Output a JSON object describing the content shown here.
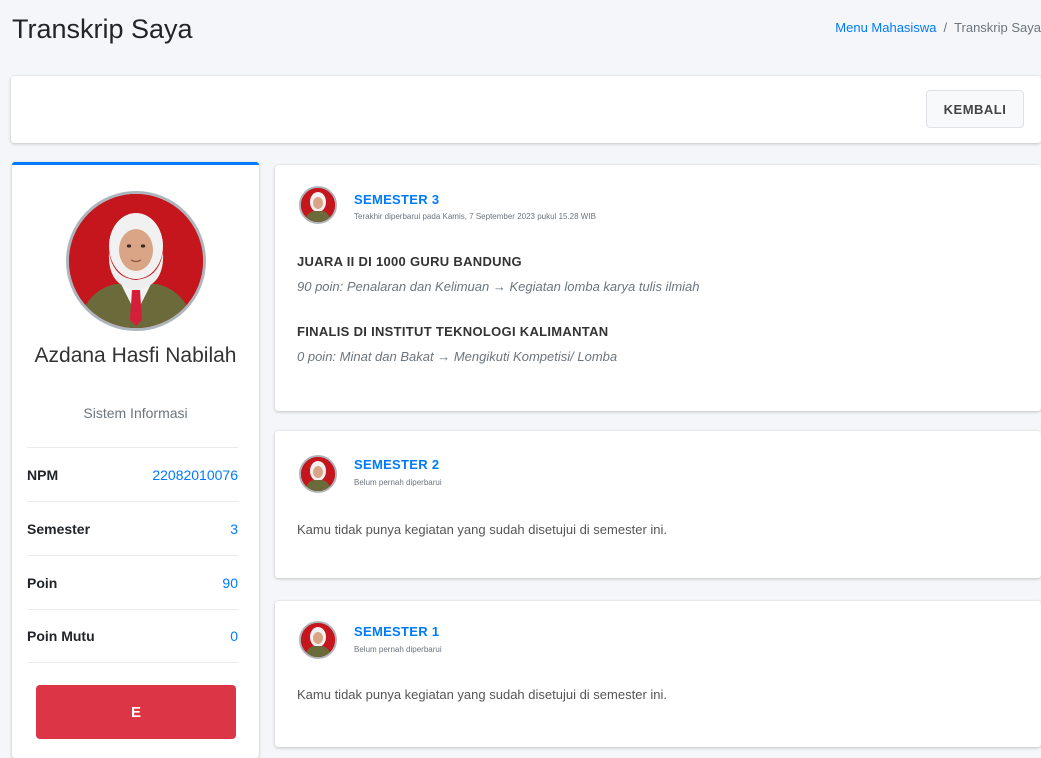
{
  "header": {
    "title": "Transkrip Saya",
    "breadcrumb": {
      "parent": "Menu Mahasiswa",
      "separator": "/",
      "current": "Transkrip Saya"
    }
  },
  "toolbar": {
    "back_label": "KEMBALI"
  },
  "profile": {
    "name": "Azdana Hasfi Nabilah",
    "major": "Sistem Informasi",
    "stats": [
      {
        "label": "NPM",
        "value": "22082010076"
      },
      {
        "label": "Semester",
        "value": "3"
      },
      {
        "label": "Poin",
        "value": "90"
      },
      {
        "label": "Poin Mutu",
        "value": "0"
      }
    ],
    "grade": "E"
  },
  "semesters": [
    {
      "title": "SEMESTER 3",
      "updated": "Terakhir diperbarui pada Kamis, 7 September 2023 pukul 15.28 WIB",
      "activities": [
        {
          "title": "JUARA II DI 1000 GURU BANDUNG",
          "desc": "90 poin: Penalaran dan Kelimuan → Kegiatan lomba karya tulis ilmiah"
        },
        {
          "title": "FINALIS DI INSTITUT TEKNOLOGI KALIMANTAN",
          "desc": "0 poin: Minat dan Bakat → Mengikuti Kompetisi/ Lomba"
        }
      ]
    },
    {
      "title": "SEMESTER 2",
      "updated": "Belum pernah diperbarui",
      "empty": "Kamu tidak punya kegiatan yang sudah disetujui di semester ini."
    },
    {
      "title": "SEMESTER 1",
      "updated": "Belum pernah diperbarui",
      "empty": "Kamu tidak punya kegiatan yang sudah disetujui di semester ini."
    }
  ],
  "colors": {
    "accent": "#007bff",
    "danger": "#dc3545",
    "background": "#f4f6f9"
  }
}
